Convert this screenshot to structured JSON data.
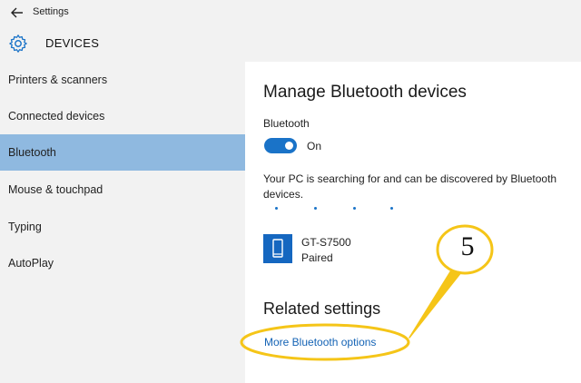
{
  "window": {
    "title": "Settings"
  },
  "header": {
    "title": "DEVICES"
  },
  "sidebar": {
    "items": [
      {
        "label": "Printers & scanners",
        "selected": false
      },
      {
        "label": "Connected devices",
        "selected": false
      },
      {
        "label": "Bluetooth",
        "selected": true
      },
      {
        "label": "Mouse & touchpad",
        "selected": false
      },
      {
        "label": "Typing",
        "selected": false
      },
      {
        "label": "AutoPlay",
        "selected": false
      }
    ]
  },
  "main": {
    "title": "Manage Bluetooth devices",
    "bluetooth_label": "Bluetooth",
    "toggle_state": "On",
    "searching_text": "Your PC is searching for and can be discovered by Bluetooth devices.",
    "device": {
      "name": "GT-S7500",
      "status": "Paired",
      "icon": "phone-icon"
    },
    "related_title": "Related settings",
    "related_link": "More Bluetooth options"
  },
  "annotation": {
    "number": "5",
    "color": "#f5c518"
  },
  "colors": {
    "accent": "#1a73c8",
    "selected_nav": "#8fb9e0",
    "link": "#1463b5"
  }
}
